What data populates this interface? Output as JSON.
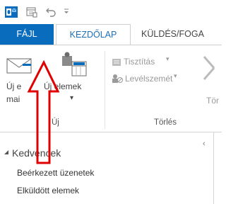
{
  "tabs": {
    "file": "FÁJL",
    "home": "KEZDŐLAP",
    "send_receive": "KÜLDÉS/FOGA"
  },
  "ribbon": {
    "new_email_line1": "Új e",
    "new_email_line2": "mai",
    "new_items_line1": "Új elemek",
    "new_items_chevron": "▾",
    "group_new": "Új",
    "cleanup": "Tisztítás",
    "junk": "Levélszemét",
    "delete_partial": "Tör",
    "group_delete": "Törlés"
  },
  "nav": {
    "favorites": "Kedvencek",
    "collapse_glyph": "‹",
    "folders": [
      "Beérkezett üzenetek",
      "Elküldött elemek"
    ]
  },
  "colors": {
    "file_tab": "#0a6cbd",
    "home_tab_text": "#1f6fb5",
    "arrow_red": "#e00000"
  }
}
